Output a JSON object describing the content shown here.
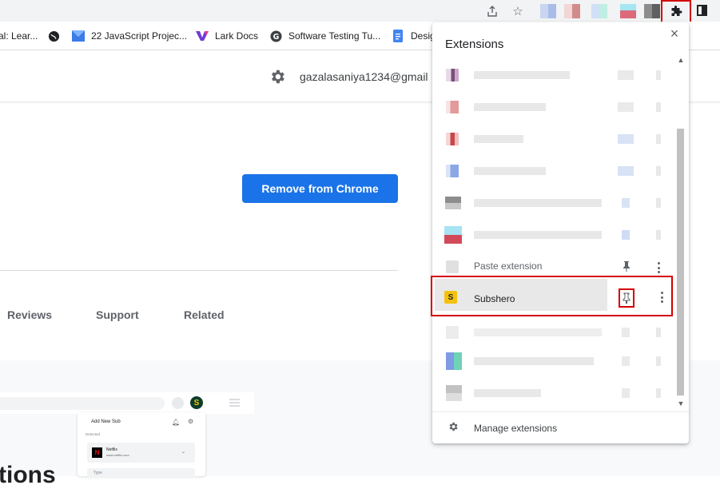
{
  "bookmarks": [
    {
      "label": "al: Lear...",
      "icon": "bookmark-icon"
    },
    {
      "label": "",
      "icon": "globe-icon"
    },
    {
      "label": "22 JavaScript Projec...",
      "icon": "m-logo-icon"
    },
    {
      "label": "Lark Docs",
      "icon": "lark-icon"
    },
    {
      "label": "Software Testing Tu...",
      "icon": "g-logo-icon"
    },
    {
      "label": "Desig",
      "icon": "docs-icon"
    }
  ],
  "header": {
    "account": "gazalasaniya1234@gmail"
  },
  "remove_button": "Remove from Chrome",
  "tabs": [
    "Reviews",
    "Support",
    "Related"
  ],
  "preview": {
    "card_title": "Add New Sub",
    "detected": "Detected",
    "service_name": "Netflix",
    "service_url": "www.netflix.com",
    "type_placeholder": "Type",
    "s_badge": "S",
    "netflix_badge": "N"
  },
  "heading_partial": "tions",
  "extensions_popup": {
    "title": "Extensions",
    "close": "×",
    "paste_extension": "Paste extension",
    "subshero": "Subshero",
    "subshero_badge": "S",
    "manage": "Manage extensions"
  },
  "colors": {
    "accent": "#1a73e8",
    "highlight_red": "#d40000",
    "subshero_yellow": "#f4c20d"
  }
}
